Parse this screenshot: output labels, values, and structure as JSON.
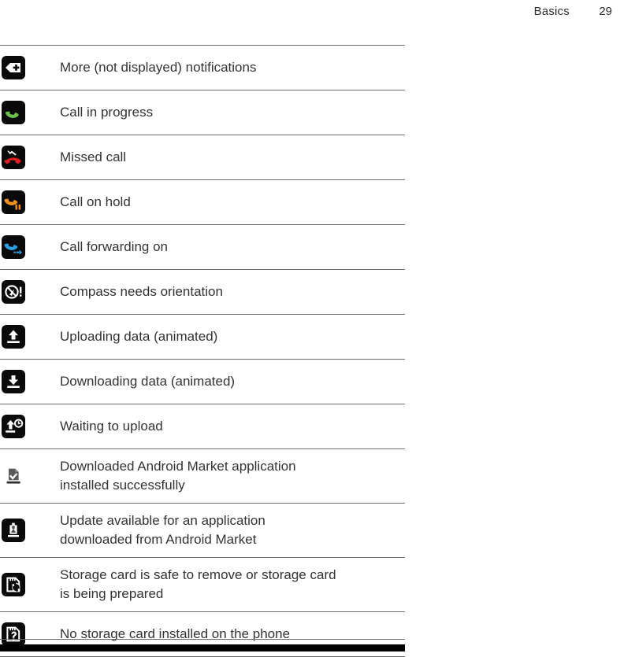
{
  "header": {
    "chapter": "Basics",
    "page_number": "29"
  },
  "table": {
    "rows": [
      {
        "icon": "more-notifications-icon",
        "label_line1": "More (not displayed) notifications",
        "label_line2": "",
        "lines": 1
      },
      {
        "icon": "call-in-progress-icon",
        "label_line1": "Call in progress",
        "label_line2": "",
        "lines": 1
      },
      {
        "icon": "missed-call-icon",
        "label_line1": "Missed call",
        "label_line2": "",
        "lines": 1
      },
      {
        "icon": "call-on-hold-icon",
        "label_line1": "Call on hold",
        "label_line2": "",
        "lines": 1
      },
      {
        "icon": "call-forwarding-icon",
        "label_line1": "Call forwarding on",
        "label_line2": "",
        "lines": 1
      },
      {
        "icon": "compass-orientation-icon",
        "label_line1": "Compass needs orientation",
        "label_line2": "",
        "lines": 1
      },
      {
        "icon": "uploading-data-icon",
        "label_line1": "Uploading data (animated)",
        "label_line2": "",
        "lines": 1
      },
      {
        "icon": "downloading-data-icon",
        "label_line1": "Downloading data (animated)",
        "label_line2": "",
        "lines": 1
      },
      {
        "icon": "waiting-to-upload-icon",
        "label_line1": "Waiting to upload",
        "label_line2": "",
        "lines": 1
      },
      {
        "icon": "app-installed-icon",
        "label_line1": "Downloaded Android Market application",
        "label_line2": "installed successfully",
        "lines": 2
      },
      {
        "icon": "app-update-available-icon",
        "label_line1": "Update available for an application",
        "label_line2": "downloaded from Android Market",
        "lines": 2
      },
      {
        "icon": "storage-card-safe-remove-icon",
        "label_line1": "Storage card is safe to remove or storage card",
        "label_line2": "is being prepared",
        "lines": 2
      },
      {
        "icon": "no-storage-card-icon",
        "label_line1": "No storage card installed on the phone",
        "label_line2": "",
        "lines": 1
      }
    ]
  },
  "colors": {
    "rule": "#6b6b6b",
    "text": "#333333",
    "badge_background": "#0a0a0a",
    "call_green": "#6cc24a",
    "missed_red": "#e02020",
    "hold_orange": "#f2901c",
    "forward_blue": "#2e9fe0"
  }
}
